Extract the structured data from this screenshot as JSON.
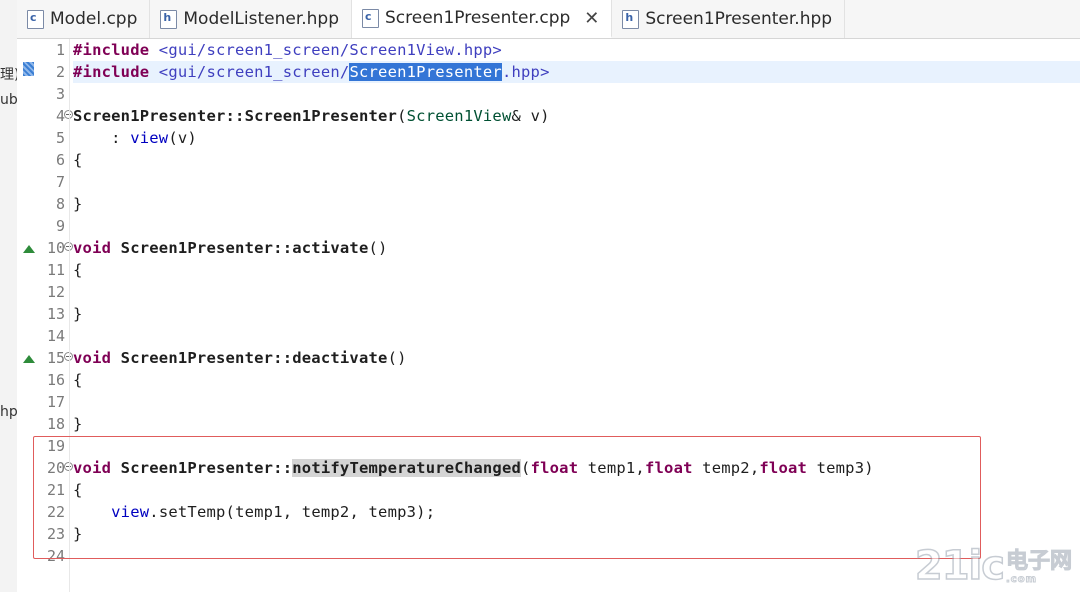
{
  "left_panel": {
    "fragments": [
      "理)",
      "ub",
      "hp"
    ]
  },
  "tabs": [
    {
      "label": "Model.cpp",
      "icon": "cpp-file-icon",
      "icon_glyph": "c",
      "active": false
    },
    {
      "label": "ModelListener.hpp",
      "icon": "header-file-icon",
      "icon_glyph": "h",
      "active": false
    },
    {
      "label": "Screen1Presenter.cpp",
      "icon": "cpp-file-icon",
      "icon_glyph": "c",
      "active": true,
      "close": "✕"
    },
    {
      "label": "Screen1Presenter.hpp",
      "icon": "header-file-icon",
      "icon_glyph": "h",
      "active": false
    }
  ],
  "editor": {
    "line_numbers": [
      "1",
      "2",
      "3",
      "4",
      "5",
      "6",
      "7",
      "8",
      "9",
      "10",
      "11",
      "12",
      "13",
      "14",
      "15",
      "16",
      "17",
      "18",
      "19",
      "20",
      "21",
      "22",
      "23",
      "24"
    ],
    "lines": {
      "l1_directive": "#include",
      "l1_path": " <gui/screen1_screen/Screen1View.hpp>",
      "l2_directive": "#include",
      "l2_path_a": " <gui/screen1_screen/",
      "l2_selected": "Screen1Presenter",
      "l2_path_b": ".hpp>",
      "l4_name": "Screen1Presenter::Screen1Presenter",
      "l4_paren": "(",
      "l4_type": "Screen1View",
      "l4_rest": "& v)",
      "l5_a": "    : ",
      "l5_member": "view",
      "l5_b": "(v)",
      "brace_open": "{",
      "brace_close": "}",
      "void_kw": "void",
      "l10_name": " Screen1Presenter::activate",
      "l10_rest": "()",
      "l15_name": " Screen1Presenter::deactivate",
      "l15_rest": "()",
      "l20_class": " Screen1Presenter::",
      "l20_method": "notifyTemperatureChanged",
      "l20_paren": "(",
      "float_kw": "float",
      "l20_p1": " temp1,",
      "l20_p2": " temp2,",
      "l20_p3": " temp3)",
      "l22_indent": "    ",
      "l22_member": "view",
      "l22_rest": ".setTemp(temp1, temp2, temp3);"
    }
  },
  "watermark": {
    "big": "21ic",
    "cn": "电子网",
    "com": ".com"
  },
  "colors": {
    "keyword": "#7f0055",
    "include_path": "#3f3fbf",
    "selection": "#3375d6",
    "highlight_box": "#e05c5c",
    "current_line": "#e8f2fe"
  }
}
